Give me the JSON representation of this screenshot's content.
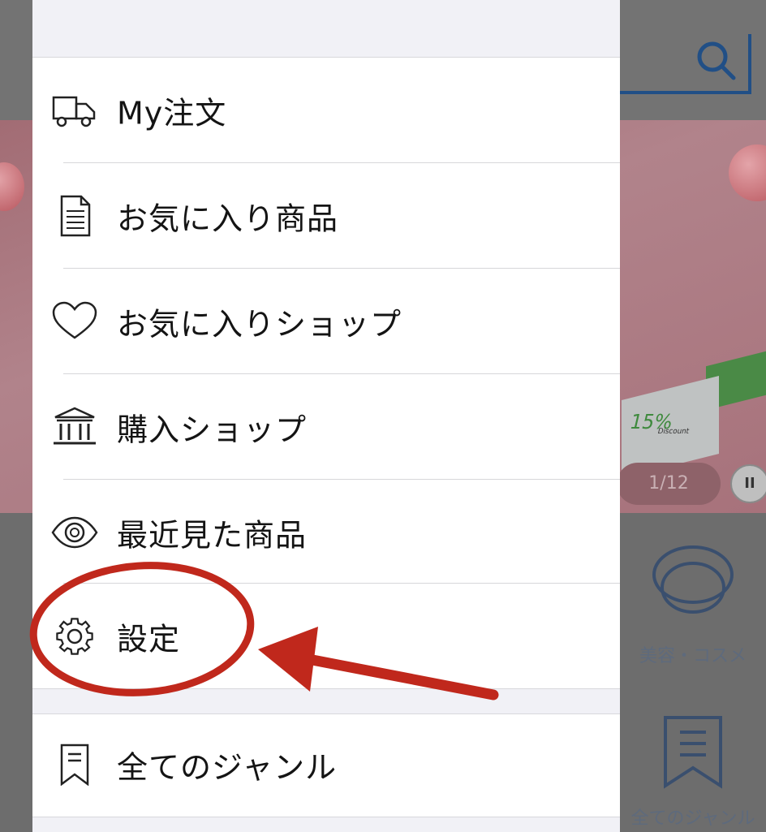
{
  "background": {
    "banner": {
      "coupon_percent": "15%",
      "coupon_word": "Discount",
      "pager": "1/12"
    },
    "genres": [
      {
        "icon": "compact-icon",
        "label": "美容・コスメ"
      },
      {
        "icon": "bookmark-icon",
        "label": "全てのジャンル"
      }
    ]
  },
  "drawer": {
    "items": [
      {
        "icon": "truck-icon",
        "label": "My注文"
      },
      {
        "icon": "document-icon",
        "label": "お気に入り商品"
      },
      {
        "icon": "heart-icon",
        "label": "お気に入りショップ"
      },
      {
        "icon": "bank-icon",
        "label": "購入ショップ"
      },
      {
        "icon": "eye-icon",
        "label": "最近見た商品"
      },
      {
        "icon": "gear-icon",
        "label": "設定"
      }
    ],
    "all_genres": {
      "icon": "bookmark-icon",
      "label": "全てのジャンル"
    }
  },
  "colors": {
    "accent": "#214f86",
    "annotation": "#c0281c",
    "drawer_bg": "#ffffff",
    "overlay": "#6d6d6d"
  }
}
